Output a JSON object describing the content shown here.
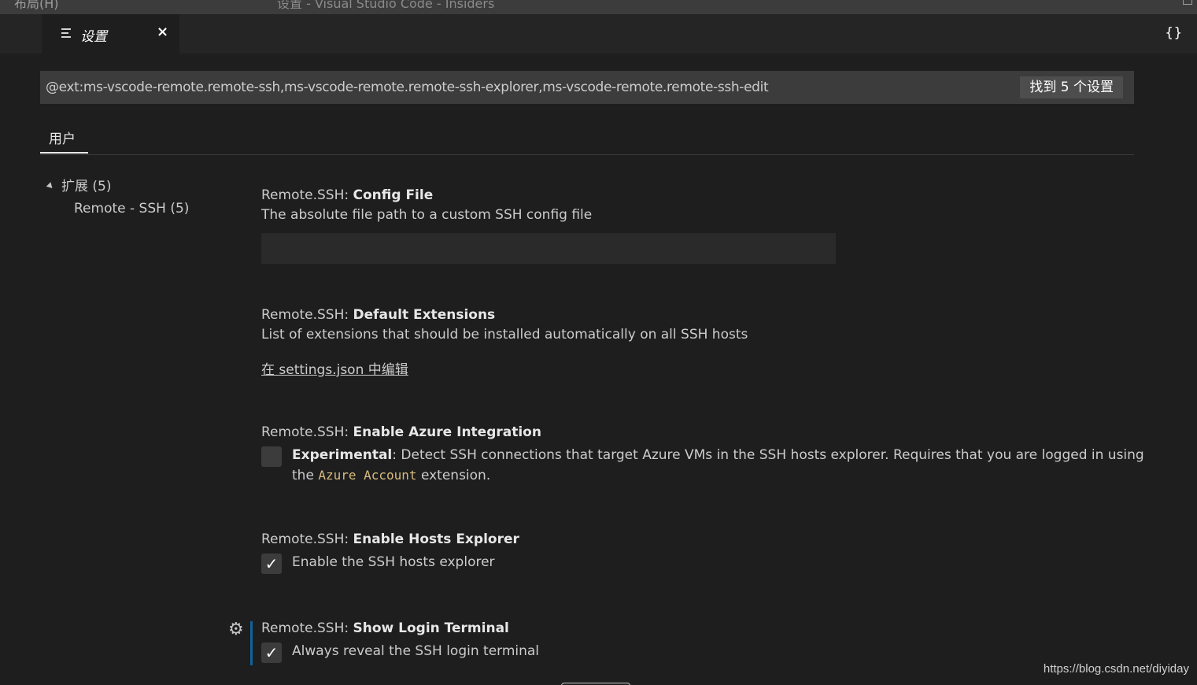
{
  "titlebar": {
    "menu_text": "布局(H)",
    "window_title": "设置 - Visual Studio Code - Insiders"
  },
  "tabbar": {
    "tab_label": "设置",
    "tab_close": "×",
    "json_button": "{}"
  },
  "search": {
    "query": "@ext:ms-vscode-remote.remote-ssh,ms-vscode-remote.remote-ssh-explorer,ms-vscode-remote.remote-ssh-edit",
    "result_badge": "找到 5 个设置"
  },
  "scope_tabs": {
    "user_label": "用户"
  },
  "toc": {
    "group_label": "扩展",
    "group_count": "(5)",
    "item_label": "Remote - SSH",
    "item_count": "(5)"
  },
  "settings": [
    {
      "category": "Remote.SSH: ",
      "name": "Config File",
      "description": "The absolute file path to a custom SSH config file",
      "value": ""
    },
    {
      "category": "Remote.SSH: ",
      "name": "Default Extensions",
      "description": "List of extensions that should be installed automatically on all SSH hosts",
      "link": "在 settings.json 中编辑"
    },
    {
      "category": "Remote.SSH: ",
      "name": "Enable Azure Integration",
      "checked": false,
      "desc_bold": "Experimental",
      "desc_part1": ": Detect SSH connections that target Azure VMs in the SSH hosts explorer. Requires that you are logged in using",
      "desc_part2_pre": "the ",
      "desc_code": "Azure Account",
      "desc_part2_post": " extension."
    },
    {
      "category": "Remote.SSH: ",
      "name": "Enable Hosts Explorer",
      "checked": true,
      "description": "Enable the SSH hosts explorer"
    },
    {
      "category": "Remote.SSH: ",
      "name": "Show Login Terminal",
      "checked": true,
      "description": "Always reveal the SSH login terminal"
    }
  ],
  "check_glyph": "✓",
  "gear_glyph": "⚙",
  "watermark": "https://blog.csdn.net/diyiday",
  "colors": {
    "background": "#1e1e1e",
    "tabbar": "#252526",
    "input": "#3c3c3c",
    "modified_indicator": "#0e639c",
    "code": "#d7ba7d"
  }
}
